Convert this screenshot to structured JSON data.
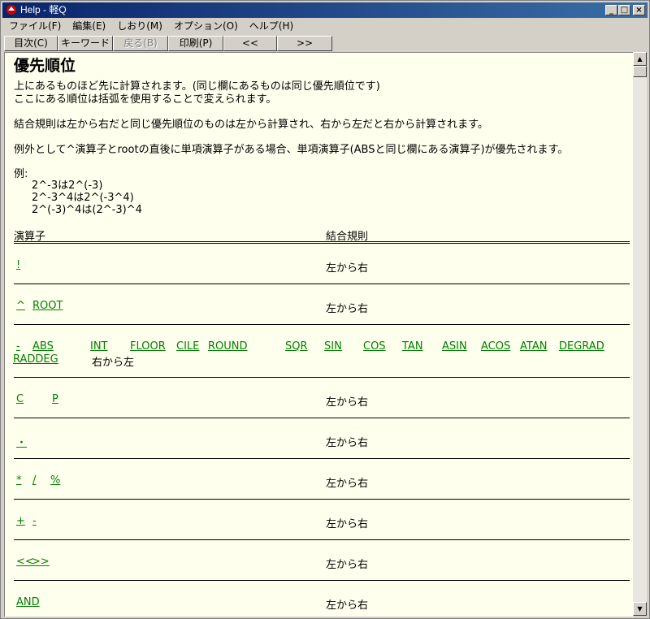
{
  "window": {
    "title": "Help - 軽Q"
  },
  "menu": [
    "ファイル(F)",
    "編集(E)",
    "しおり(M)",
    "オプション(O)",
    "ヘルプ(H)"
  ],
  "toolbar": {
    "contents": "目次(C)",
    "keyword": "キーワード(I)",
    "back": "戻る(B)",
    "print": "印刷(P)",
    "prev": "<<",
    "next": ">>"
  },
  "page": {
    "heading": "優先順位",
    "intro1": "上にあるものほど先に計算されます。(同じ欄にあるものは同じ優先順位です)",
    "intro2": "ここにある順位は括弧を使用することで変えられます。",
    "assoc": "結合規則は左から右だと同じ優先順位のものは左から計算され、右から左だと右から計算されます。",
    "exception": "例外として^演算子とrootの直後に単項演算子がある場合、単項演算子(ABSと同じ欄にある演算子)が優先されます。",
    "example_label": "例:",
    "examples": [
      "2^-3は2^(-3)",
      "2^-3^4は2^(-3^4)",
      "2^(-3)^4は(2^-3)^4"
    ]
  },
  "table": {
    "col_operator": "演算子",
    "col_assoc": "結合規則",
    "rows": [
      {
        "ops": [
          "!"
        ],
        "assoc": "左から右"
      },
      {
        "ops": [
          "^",
          "ROOT"
        ],
        "assoc": "左から右"
      },
      {
        "ops": [
          "-",
          "ABS",
          "INT",
          "FLOOR",
          "CILE",
          "ROUND",
          "SQR",
          "SIN",
          "COS",
          "TAN",
          "ASIN",
          "ACOS",
          "ATAN",
          "DEGRAD",
          "RADDEG"
        ],
        "assoc": "右から左"
      },
      {
        "ops": [
          "C",
          "P"
        ],
        "assoc": "左から右"
      },
      {
        "ops": [
          "・"
        ],
        "assoc": "左から右"
      },
      {
        "ops": [
          "*",
          "/",
          "%"
        ],
        "assoc": "左から右"
      },
      {
        "ops": [
          "+",
          "-"
        ],
        "assoc": "左から右"
      },
      {
        "ops": [
          "<<",
          ">>"
        ],
        "assoc": "左から右"
      },
      {
        "ops": [
          "AND"
        ],
        "assoc": "左から右"
      }
    ]
  }
}
